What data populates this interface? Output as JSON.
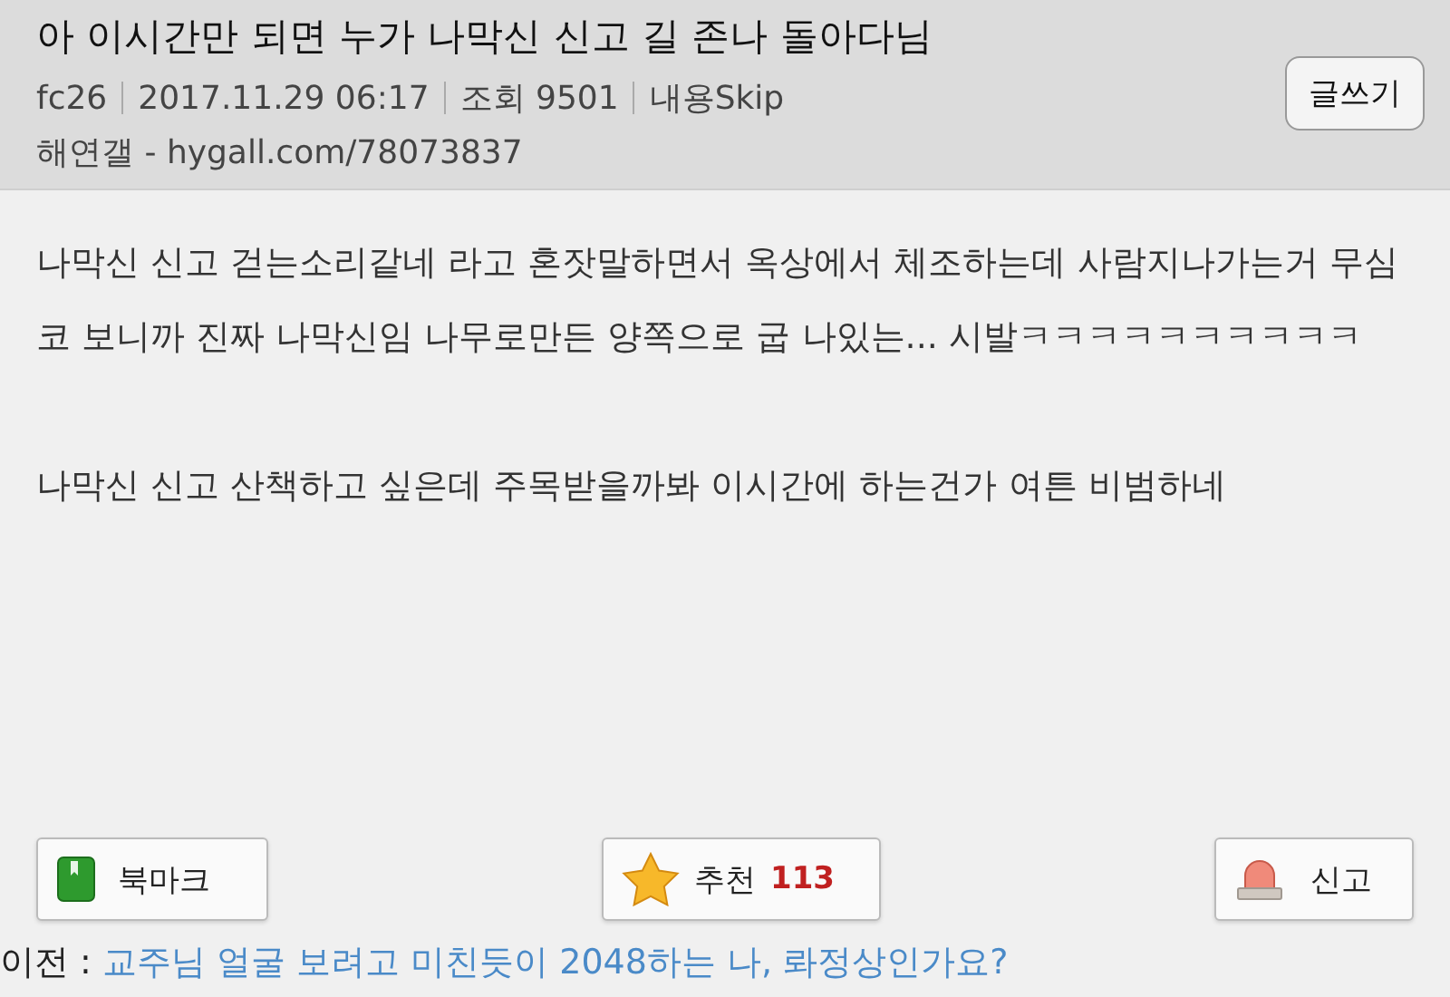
{
  "header": {
    "title": "아 이시간만 되면 누가 나막신 신고 길 존나 돌아다님",
    "meta": [
      "fc26",
      "2017.11.29 06:17",
      "조회 9501",
      "내용Skip"
    ],
    "source": "해연갤 - hygall.com/78073837",
    "write_button": "글쓰기"
  },
  "body": {
    "paragraphs": [
      "나막신 신고 걷는소리같네 라고 혼잣말하면서 옥상에서 체조하는데 사람지나가는거 무심코 보니까 진짜 나막신임 나무로만든 양쪽으로 굽 나있는... 시발ㅋㅋㅋㅋㅋㅋㅋㅋㅋㅋ",
      "나막신 신고 산책하고 싶은데 주목받을까봐 이시간에 하는건가 여튼 비범하네"
    ]
  },
  "actions": [
    {
      "kind": "bookmark",
      "label": "북마크"
    },
    {
      "kind": "recommend",
      "label": "추천",
      "count": "113"
    },
    {
      "kind": "report",
      "label": "신고"
    }
  ],
  "previous": {
    "label": "이전 :",
    "link": "교주님 얼굴 보려고 미친듯이 2048하는 나, 롸정상인가요?"
  }
}
